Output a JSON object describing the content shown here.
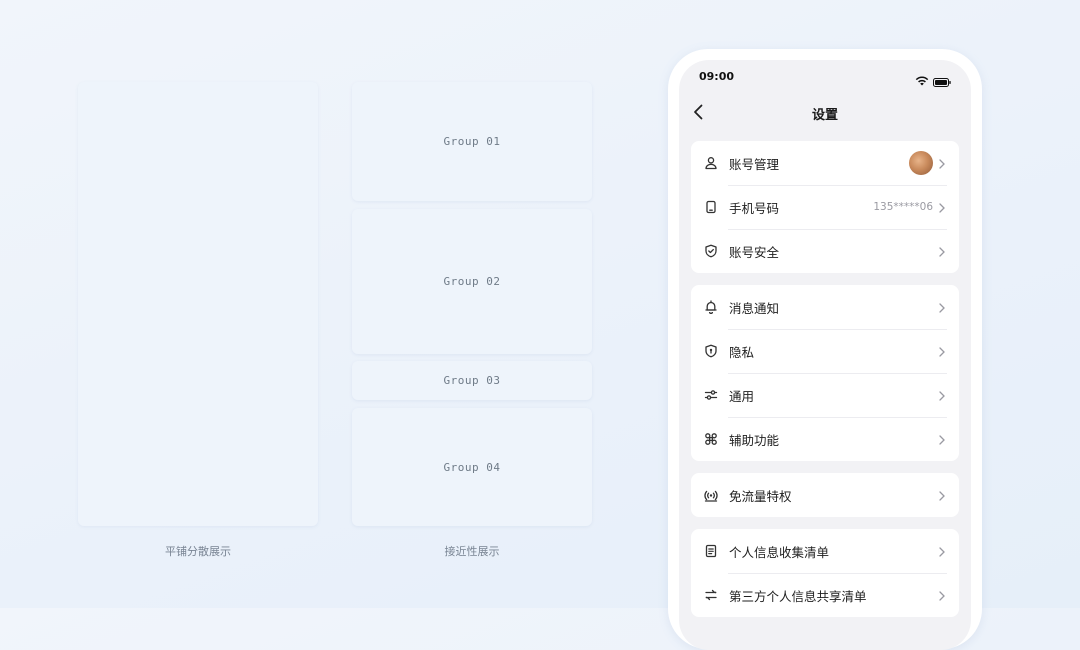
{
  "left": {
    "caption": "平铺分散展示"
  },
  "middle": {
    "groups": [
      "Group 01",
      "Group 02",
      "Group 03",
      "Group 04"
    ],
    "caption": "接近性展示"
  },
  "phone": {
    "status": {
      "time": "09:00"
    },
    "nav": {
      "title": "设置"
    },
    "sections": [
      [
        {
          "label": "账号管理",
          "icon": "user-icon",
          "value": "",
          "has_avatar": true
        },
        {
          "label": "手机号码",
          "icon": "phone-icon",
          "value": "135*****06"
        },
        {
          "label": "账号安全",
          "icon": "shield-check-icon",
          "value": ""
        }
      ],
      [
        {
          "label": "消息通知",
          "icon": "bell-icon",
          "value": ""
        },
        {
          "label": "隐私",
          "icon": "privacy-shield-icon",
          "value": ""
        },
        {
          "label": "通用",
          "icon": "sliders-icon",
          "value": ""
        },
        {
          "label": "辅助功能",
          "icon": "command-icon",
          "value": ""
        }
      ],
      [
        {
          "label": "免流量特权",
          "icon": "signal-icon",
          "value": ""
        }
      ],
      [
        {
          "label": "个人信息收集清单",
          "icon": "document-icon",
          "value": ""
        },
        {
          "label": "第三方个人信息共享清单",
          "icon": "share-icon",
          "value": ""
        }
      ]
    ]
  }
}
